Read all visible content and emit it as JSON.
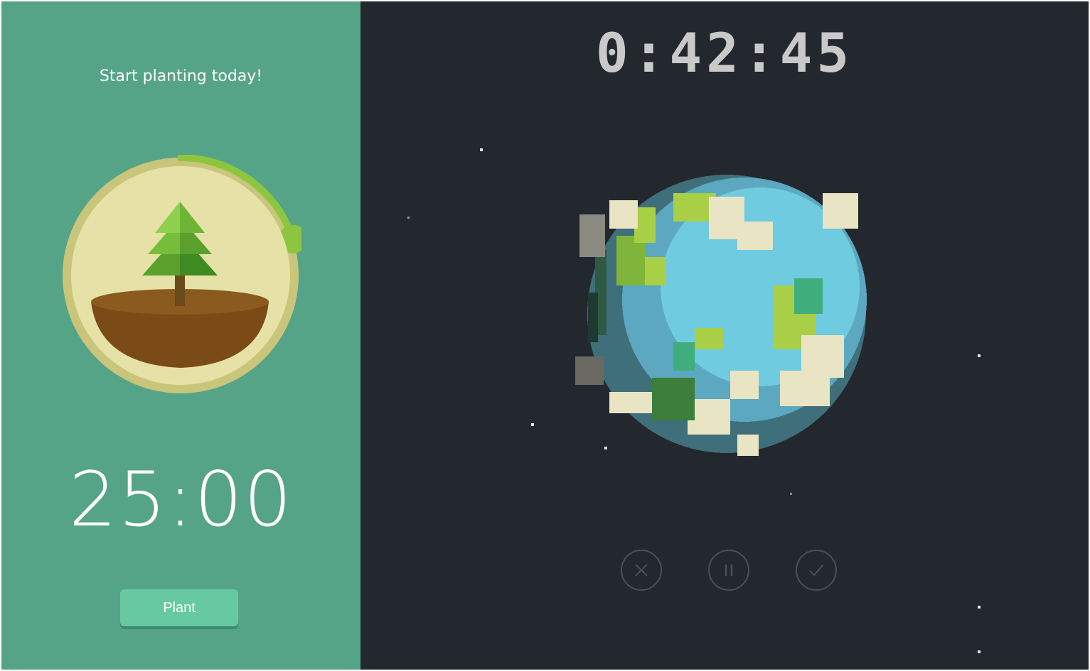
{
  "left_panel": {
    "tagline": "Start planting today!",
    "countdown": "25:00",
    "plant_label": "Plant",
    "session_progress": 0.2,
    "icon": "pine-tree-icon"
  },
  "right_panel": {
    "elapsed_time": "0:42:45",
    "icon": "pixel-earth-icon",
    "controls": [
      {
        "name": "cancel",
        "icon": "close-icon"
      },
      {
        "name": "pause",
        "icon": "pause-icon"
      },
      {
        "name": "complete",
        "icon": "checkmark-icon"
      }
    ]
  },
  "colors": {
    "left_background": "#55a487",
    "right_background": "#23272e",
    "plant_button": "#67c9a2",
    "progress_green": "#8cc63f"
  }
}
